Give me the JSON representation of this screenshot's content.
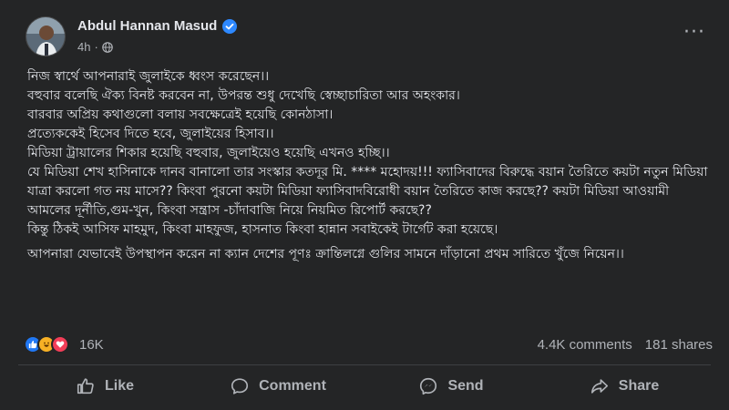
{
  "post": {
    "author_name": "Abdul Hannan Masud",
    "time": "4h",
    "separator": "·",
    "more_label": "···",
    "text_lines": [
      "নিজ স্বার্থে আপনারাই জুলাইকে ধ্বংস করেছেন।।",
      "বহুবার বলেছি ঐক্য বিনষ্ট করবেন না, উপরন্ত শুধু দেখেছি স্বেচ্ছাচারিতা আর অহংকার।",
      "বারবার অপ্রিয় কথাগুলো বলায় সবক্ষেত্রেই হয়েছি কোনঠাসা।",
      "প্রত্যেককেই হিসেব দিতে হবে, জুলাইয়ের হিসাব।।",
      "মিডিয়া ট্রায়ালের শিকার হয়েছি বহুবার, জুলাইয়েও হয়েছি এখনও হচ্ছি।।",
      "যে মিডিয়া শেখ হাসিনাকে দানব বানালো তার সংস্কার কতদূর মি. **** মহোদয়!!! ফ্যাসিবাদের বিরুদ্ধে বয়ান তৈরিতে কয়টা নতুন মিডিয়া যাত্রা করলো গত নয় মাসে?? কিংবা পুরনো কয়টা মিডিয়া ফ্যাসিবাদবিরোধী বয়ান তৈরিতে কাজ করছে?? কয়টা মিডিয়া আওয়ামী আমলের দূর্নীতি,গুম-খুন, কিংবা সন্ত্রাস -চাঁদাবাজি নিয়ে নিয়মিত রিপোর্ট করছে??",
      "কিন্তু ঠিকই আসিফ মাহমুদ, কিংবা মাহফুজ, হাসনাত কিংবা হান্নান সবাইকেই টার্গেট করা হয়েছে।"
    ],
    "final_paragraph": "আপনারা যেভাবেই উপস্থাপন করেন না ক্যান দেশের পূণঃ ক্রান্তিলগ্নে গুলির সামনে দাঁড়ানো প্রথম সারিতে খুঁজে নিয়েন।।"
  },
  "stats": {
    "reaction_count": "16K",
    "comments": "4.4K comments",
    "shares": "181 shares"
  },
  "actions": {
    "like": "Like",
    "comment": "Comment",
    "send": "Send",
    "share": "Share"
  },
  "icons": {
    "verified": "verified-badge-icon",
    "globe": "globe-icon",
    "more": "more-options-icon",
    "reactions": [
      "like-reaction-icon",
      "haha-reaction-icon",
      "love-reaction-icon"
    ]
  },
  "colors": {
    "background": "#242526",
    "text": "#e4e6eb",
    "secondary_text": "#b0b3b8",
    "verified_blue": "#2d88ff",
    "like_blue": "#2078f4",
    "love_red": "#f33e58",
    "haha_yellow": "#f7b125"
  }
}
